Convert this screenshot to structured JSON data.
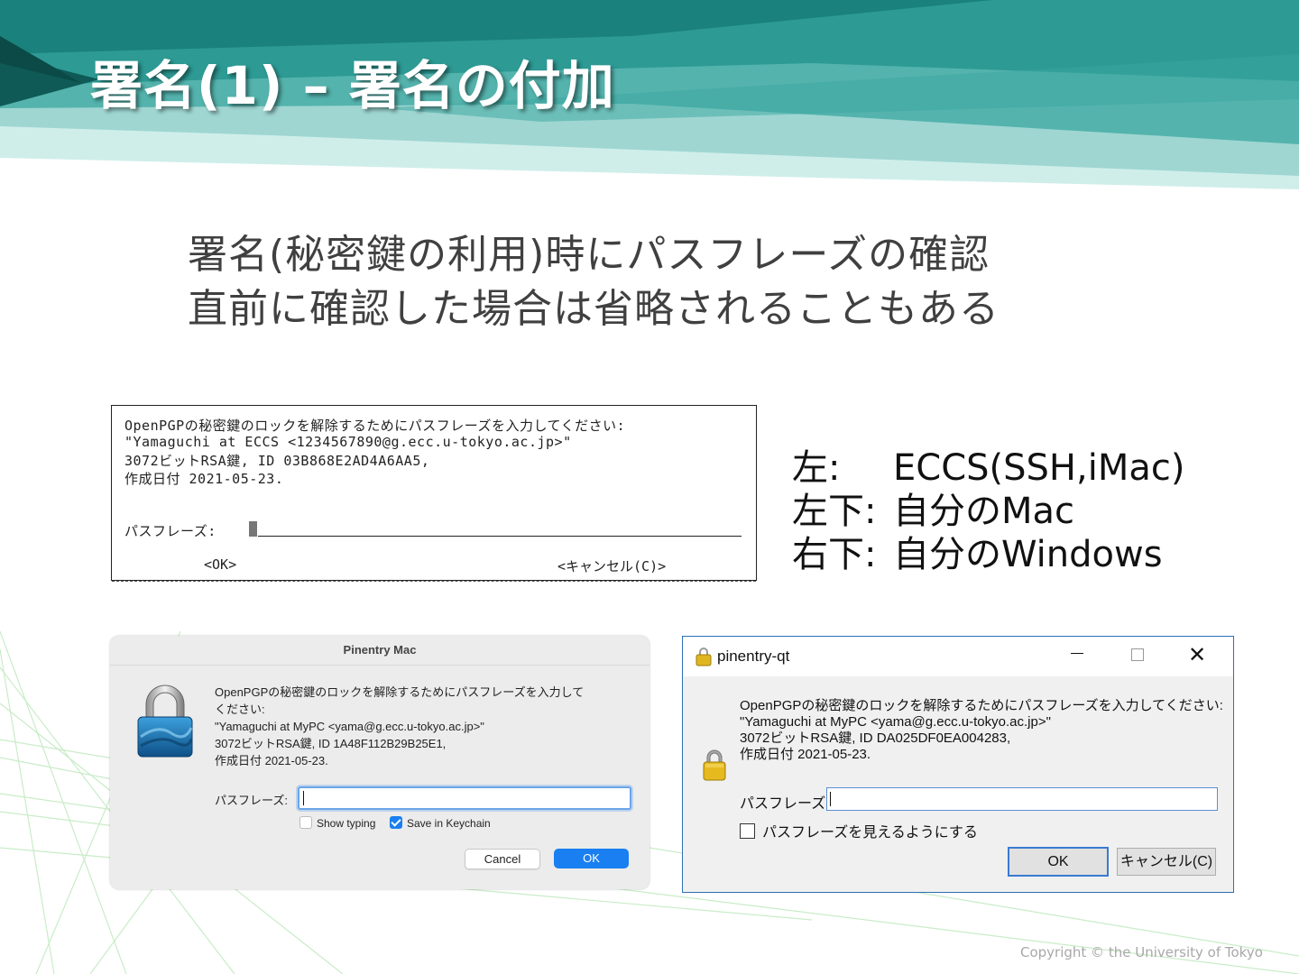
{
  "slide": {
    "title": "署名(1) – 署名の付加",
    "bullets": [
      "署名(秘密鍵の利用)時にパスフレーズの確認",
      "直前に確認した場合は省略されることもある"
    ],
    "copyright": "Copyright © the University of Tokyo"
  },
  "colors": {
    "banner_dark": "#0f6e6a",
    "banner_mid": "#2d9a94",
    "banner_light": "#9fd6d2",
    "mac_accent": "#1a7ff0",
    "win_accent": "#3a7ad0"
  },
  "terminal": {
    "lines": [
      "OpenPGPの秘密鍵のロックを解除するためにパスフレーズを入力してください:",
      "\"Yamaguchi at ECCS <1234567890@g.ecc.u-tokyo.ac.jp>\"",
      "3072ビットRSA鍵, ID 03B868E2AD4A6AA5,",
      "作成日付 2021-05-23."
    ],
    "pass_label": "パスフレーズ:",
    "ok_label": "<OK>",
    "cancel_label": "<キャンセル(C)>"
  },
  "legend": [
    {
      "key": "左:",
      "value": "ECCS(SSH,iMac)"
    },
    {
      "key": "左下:",
      "value": "自分のMac"
    },
    {
      "key": "右下:",
      "value": "自分のWindows"
    }
  ],
  "mac_dialog": {
    "title": "Pinentry Mac",
    "icon": "padlock-icon",
    "message": "OpenPGPの秘密鍵のロックを解除するためにパスフレーズを入力して\nください:\n\"Yamaguchi at MyPC <yama@g.ecc.u-tokyo.ac.jp>\"\n3072ビットRSA鍵, ID 1A48F112B29B25E1,\n作成日付 2021-05-23.",
    "pass_label": "パスフレーズ:",
    "pass_value": "",
    "show_typing_label": "Show typing",
    "show_typing_checked": false,
    "save_keychain_label": "Save in Keychain",
    "save_keychain_checked": true,
    "cancel_label": "Cancel",
    "ok_label": "OK"
  },
  "win_dialog": {
    "title": "pinentry-qt",
    "icon": "padlock-icon",
    "message": "OpenPGPの秘密鍵のロックを解除するためにパスフレーズを入力してください:\n\"Yamaguchi at MyPC <yama@g.ecc.u-tokyo.ac.jp>\"\n3072ビットRSA鍵, ID DA025DF0EA004283,\n作成日付 2021-05-23.",
    "pass_label": "パスフレーズ:",
    "pass_value": "",
    "show_label": "パスフレーズを見えるようにする",
    "show_checked": false,
    "ok_label": "OK",
    "cancel_label": "キャンセル(C)"
  }
}
